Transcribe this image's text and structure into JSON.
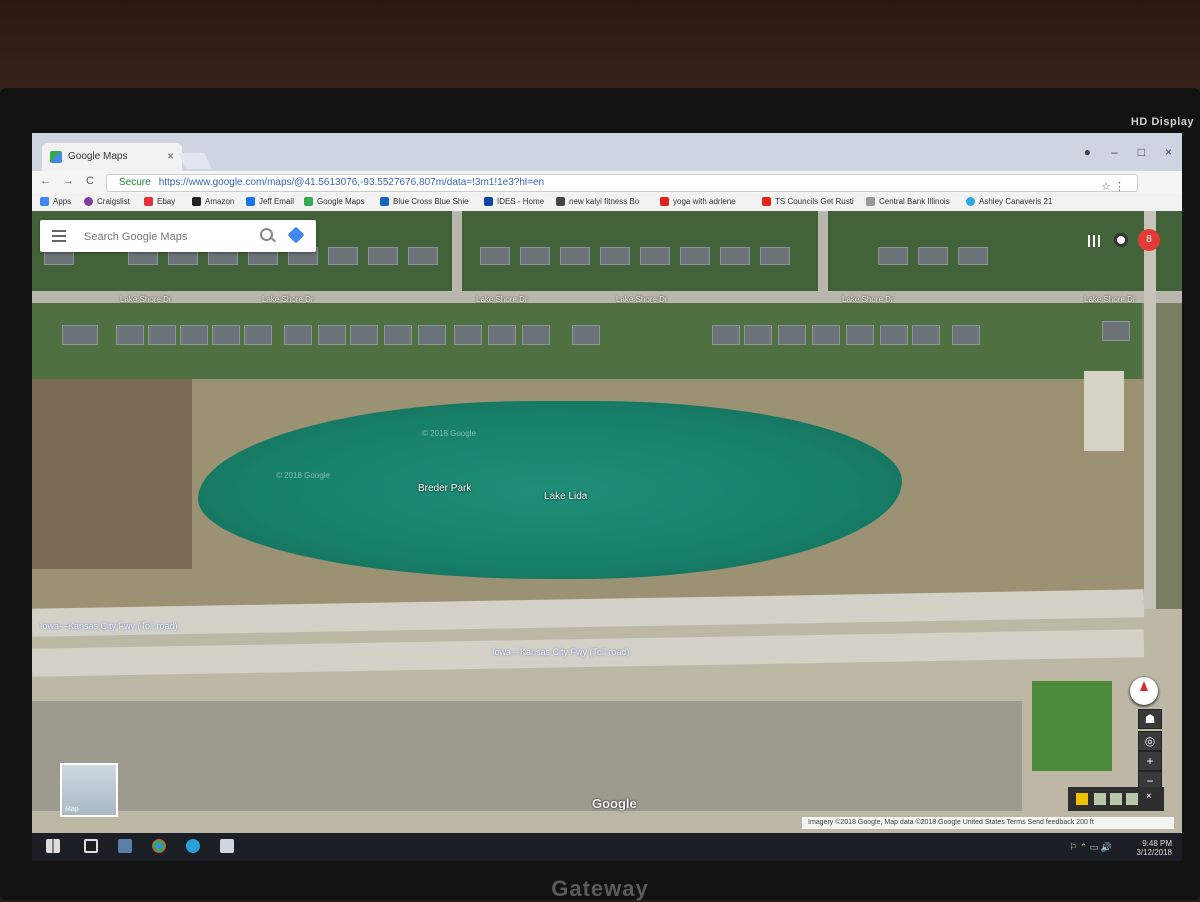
{
  "monitor": {
    "hd_label": "HD Display",
    "brand": "Gateway"
  },
  "browser": {
    "tab_title": "Google Maps",
    "tab_close": "×",
    "window_controls": [
      "●",
      "–",
      "□",
      "×"
    ],
    "nav": [
      "←",
      "→",
      "C",
      "⌂"
    ],
    "secure_label": "Secure",
    "url": "https://www.google.com/maps/@41.5613076,-93.5527676,807m/data=!3m1!1e3?hl=en",
    "omnibox_icons": "☆  ⋮",
    "bookmarks": [
      "Apps",
      "Craigslist",
      "Ebay",
      "Amazon",
      "Jeff Email",
      "Google Maps",
      "Blue Cross Blue Shie",
      "IDES - Home",
      "new kalyi fitness Bo",
      "yoga with adriene",
      "TS Councils Get Rusti",
      "Central Bank Illinois",
      "Ashley Canaveris 21"
    ]
  },
  "map": {
    "search_placeholder": "Search Google Maps",
    "account_initial": "8",
    "labels": {
      "park": "Breder Park",
      "lake": "Lake Lida",
      "hw_upper": "Iowa—Kansas City Fwy (Toll road)",
      "hw_lower": "Iowa—Kansas City Fwy (Toll road)",
      "streets": [
        "Lake Shore Dr",
        "Lake Shore Dr",
        "Lake Shore Dr",
        "Lake Shore Dr",
        "Lake Shore Dr",
        "Lake Shore Dr"
      ],
      "google_wm": "Google",
      "copyright_1": "© 2018 Google",
      "copyright_2": "© 2018 Google"
    },
    "zoom_in": "+",
    "zoom_out": "−",
    "layers_label": "Map",
    "attribution": "Imagery ©2018 Google, Map data ©2018 Google   United States   Terms   Send feedback   200 ft"
  },
  "taskbar": {
    "time": "9:48 PM",
    "date": "3/12/2018"
  }
}
